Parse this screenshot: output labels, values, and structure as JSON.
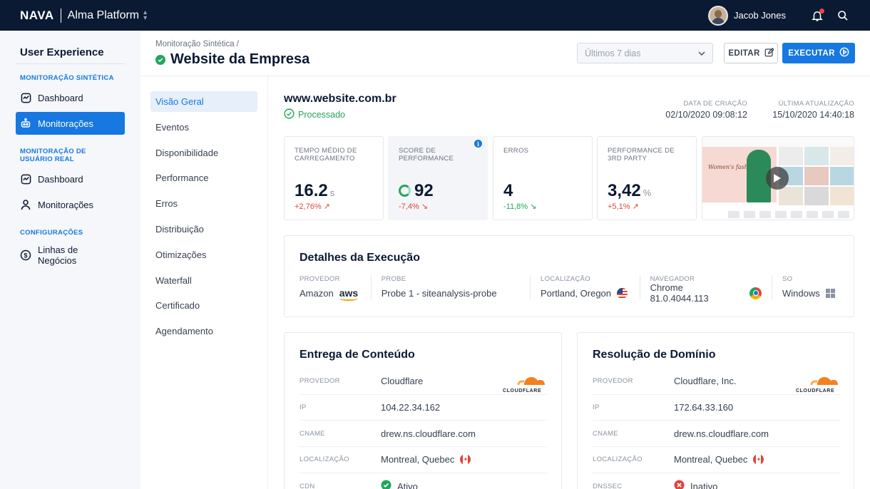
{
  "topbar": {
    "brand": "NAVA",
    "platform": "Alma Platform",
    "user_name": "Jacob Jones",
    "icons": [
      "avatar",
      "bell-icon",
      "search-icon"
    ]
  },
  "sidebar": {
    "title": "User Experience",
    "sections": [
      {
        "heading": "MONITORAÇÃO SINTÉTICA",
        "items": [
          {
            "label": "Dashboard",
            "icon": "dashboard-icon",
            "active": false
          },
          {
            "label": "Monitorações",
            "icon": "robot-icon",
            "active": true
          }
        ]
      },
      {
        "heading": "MONITORAÇÃO DE USUÁRIO REAL",
        "items": [
          {
            "label": "Dashboard",
            "icon": "dashboard-icon",
            "active": false
          },
          {
            "label": "Monitorações",
            "icon": "user-icon",
            "active": false
          }
        ]
      },
      {
        "heading": "CONFIGURAÇÕES",
        "items": [
          {
            "label": "Linhas de Negócios",
            "icon": "dollar-icon",
            "active": false
          }
        ]
      }
    ]
  },
  "header": {
    "breadcrumb": "Monitoração Sintética /",
    "title": "Website da Empresa",
    "range_placeholder": "Últimos 7 dias",
    "edit_label": "EDITAR",
    "run_label": "EXECUTAR"
  },
  "subnav": [
    "Visão Geral",
    "Eventos",
    "Disponibilidade",
    "Performance",
    "Erros",
    "Distribuição",
    "Otimizações",
    "Waterfall",
    "Certificado",
    "Agendamento"
  ],
  "site": {
    "url": "www.website.com.br",
    "status": "Processado",
    "created_label": "DATA DE CRIAÇÃO",
    "created_value": "02/10/2020 09:08:12",
    "updated_label": "ÚLTIMA ATUALIZAÇÃO",
    "updated_value": "15/10/2020 14:40:18"
  },
  "kpis": [
    {
      "label": "TEMPO MÉDIO DE CARREGAMENTO",
      "value": "16.2",
      "unit": "s",
      "delta": "+2,76%",
      "trend": "up",
      "color": "#e0453a"
    },
    {
      "label": "SCORE DE PERFORMANCE",
      "value": "92",
      "unit": "",
      "delta": "-7,4%",
      "trend": "down",
      "color": "#e0453a"
    },
    {
      "label": "ERROS",
      "value": "4",
      "unit": "",
      "delta": "-11,8%",
      "trend": "down",
      "color": "#22a55b"
    },
    {
      "label": "PERFORMANCE DE 3RD PARTY",
      "value": "3,42",
      "unit": "%",
      "delta": "+5,1%",
      "trend": "up",
      "color": "#e0453a"
    }
  ],
  "screenshot": {
    "hero_text": "Women's fashion"
  },
  "execution": {
    "title": "Detalhes da Execução",
    "columns": [
      {
        "label": "PROVEDOR",
        "value": "Amazon",
        "icon": "aws-logo"
      },
      {
        "label": "PROBE",
        "value": "Probe 1 - siteanalysis-probe"
      },
      {
        "label": "LOCALIZAÇÃO",
        "value": "Portland, Oregon",
        "icon": "us-flag-icon"
      },
      {
        "label": "NAVEGADOR",
        "value": "Chrome 81.0.4044.113",
        "icon": "chrome-icon"
      },
      {
        "label": "SO",
        "value": "Windows",
        "icon": "windows-icon"
      }
    ]
  },
  "delivery": {
    "title": "Entrega de Conteúdo",
    "logo": "CLOUDFLARE",
    "rows": [
      {
        "label": "PROVEDOR",
        "value": "Cloudflare"
      },
      {
        "label": "IP",
        "value": "104.22.34.162"
      },
      {
        "label": "CNAME",
        "value": "drew.ns.cloudflare.com"
      },
      {
        "label": "LOCALIZAÇÃO",
        "value": "Montreal, Quebec"
      },
      {
        "label": "CDN",
        "value": "Ativo"
      }
    ]
  },
  "domain": {
    "title": "Resolução de Domínio",
    "logo": "CLOUDFLARE",
    "rows": [
      {
        "label": "PROVEDOR",
        "value": "Cloudflare, Inc."
      },
      {
        "label": "IP",
        "value": "172.64.33.160"
      },
      {
        "label": "CNAME",
        "value": "drew.ns.cloudflare.com"
      },
      {
        "label": "LOCALIZAÇÃO",
        "value": "Montreal, Quebec"
      },
      {
        "label": "DNSSEC",
        "value": "Inativo"
      }
    ]
  },
  "colors": {
    "accent": "#1678e0",
    "navy": "#0b1a33",
    "success": "#22a55b",
    "danger": "#e0453a"
  }
}
